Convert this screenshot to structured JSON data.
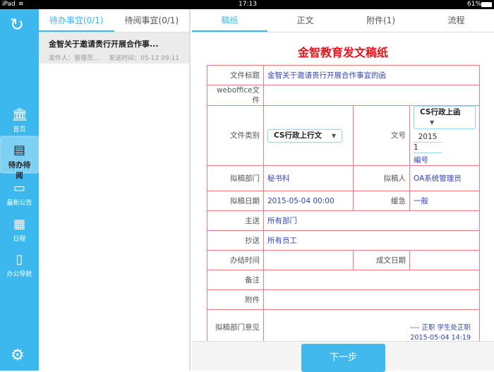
{
  "status": {
    "device": "iPad",
    "time": "17:13",
    "battery": "61%"
  },
  "sidebar": {
    "items": [
      {
        "label": "首页",
        "icon": "bank-icon"
      },
      {
        "label": "待办待阅",
        "icon": "inbox-icon"
      },
      {
        "label": "最新公告",
        "icon": "card-icon"
      },
      {
        "label": "日程",
        "icon": "calendar-icon"
      },
      {
        "label": "办公导航",
        "icon": "book-icon"
      }
    ]
  },
  "list": {
    "tabs": [
      "待办事宜(0/1)",
      "待阅事宜(0/1)"
    ],
    "items": [
      {
        "title": "金智关于邀请贵行开展合作事...",
        "sender": "发件人：管理员...",
        "time": "发送时间：05-12 09:11"
      }
    ]
  },
  "main": {
    "tabs": [
      "稿纸",
      "正文",
      "附件(1)",
      "流程"
    ],
    "title": "金智教育发文稿纸",
    "form": {
      "doc_title_label": "文件标题",
      "doc_title": "金智关于邀请贵行开展合作事宜的函",
      "weboffice_label": "weboffice文件",
      "category_label": "文件类别",
      "category": "CS行政上行文",
      "docno_label": "文号",
      "docno_type": "CS行政上函",
      "year": "2015",
      "seq": "1",
      "numbering": "编号",
      "dept_label": "拟稿部门",
      "dept": "秘书科",
      "drafter_label": "拟稿人",
      "drafter": "OA系统管理员",
      "date_label": "拟稿日期",
      "date": "2015-05-04 00:00",
      "urgency_label": "缓急",
      "urgency": "一般",
      "to_label": "主送",
      "to": "所有部门",
      "cc_label": "抄送",
      "cc": "所有员工",
      "deadline_label": "办结时间",
      "done_date_label": "成文日期",
      "remark_label": "备注",
      "attach_label": "附件",
      "opinion_label": "拟稿部门意见",
      "opinion": "---- 正职 学生处正职",
      "opinion_time": "2015-05-04 14:19"
    },
    "next_button": "下一步"
  }
}
